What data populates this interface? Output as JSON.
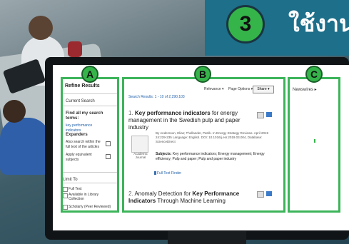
{
  "header": {
    "step_number": "3",
    "title_partial": "ใช้งาน"
  },
  "panel_labels": {
    "a": "A",
    "b": "B",
    "c": "C"
  },
  "sidebar": {
    "title": "Refine Results",
    "current_search": "Current Search",
    "find_all": "Find all my search terms:",
    "search_term": "key performance indicators",
    "expanders": "Expanders",
    "also_search": "Also search within the full text of the articles",
    "apply_equivalent": "Apply equivalent subjects",
    "limit_to": "Limit To",
    "limit_options": [
      "Full Text",
      "Available in Library Collection",
      "Scholarly (Peer Reviewed)"
    ]
  },
  "results": {
    "count_text": "Search Results: 1 - 10 of 2,290,103",
    "sort_label": "Relevance ▾",
    "page_options": "Page Options ▾",
    "share": "Share ▾",
    "r1": {
      "num": "1.",
      "title_bold": "Key performance indicators",
      "title_rest": " for energy management in the Swedish pulp and paper industry",
      "authors": "By Andersson, Elias; Thollander, Patrik. In Energy Strategy Reviews. April 2019 24:229-235 Language: English. DOI: 10.1016/j.esr.2019.03.004, Database: ScienceDirect",
      "subjects_label": "Subjects:",
      "subjects": " Key performance indicators; Energy management; Energy efficiency; Pulp and paper; Pulp and paper industry",
      "type": "Academic Journal",
      "full_text": "Full Text Finder"
    },
    "r2": {
      "num": "2.",
      "prefix": "Anomaly Detection for ",
      "title_bold": "Key Performance Indicators",
      "title_rest": " Through Machine Learning"
    }
  },
  "right_panel": {
    "newswires": "Newswires ▸"
  },
  "colors": {
    "accent_green": "#35b44a",
    "teal": "#1d6f8a",
    "link_blue": "#1f5fa8"
  }
}
